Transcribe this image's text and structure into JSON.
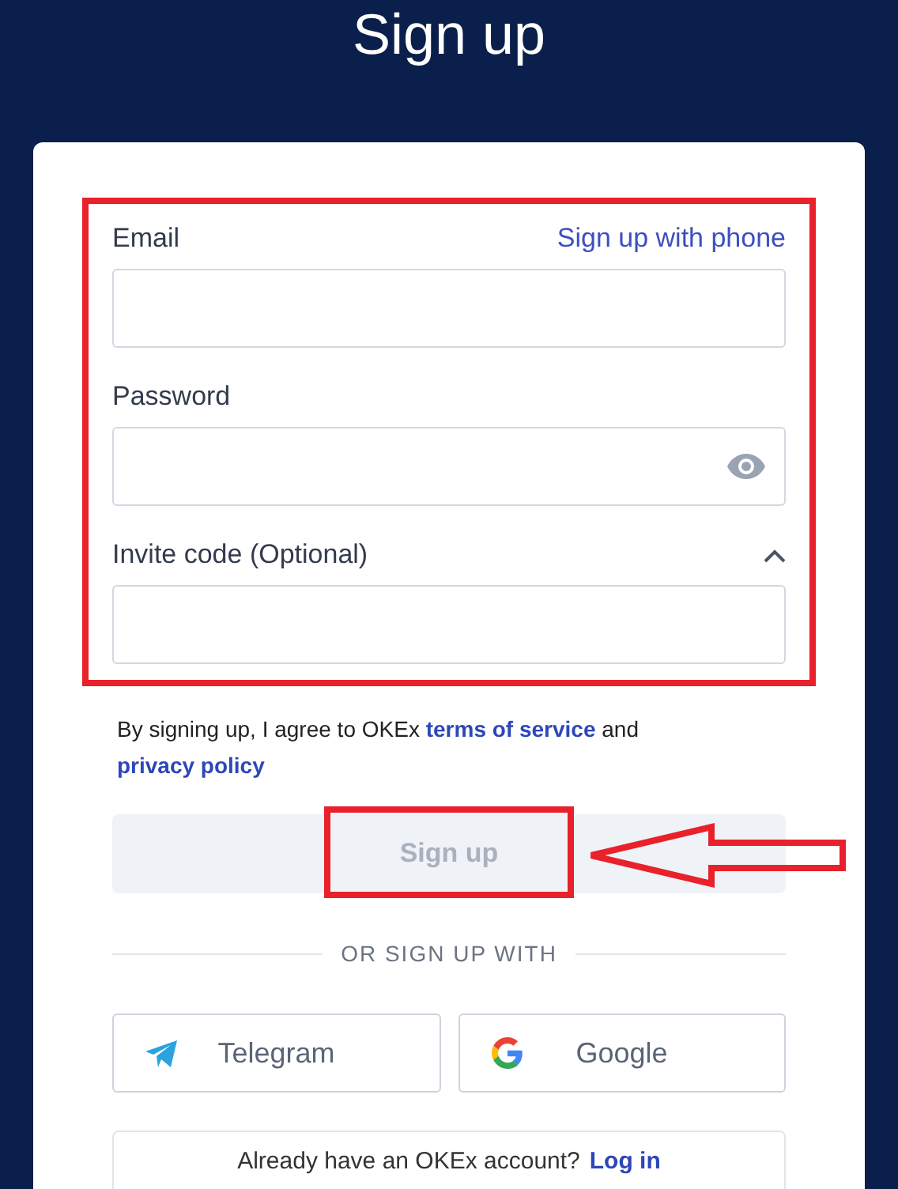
{
  "title": "Sign up",
  "form": {
    "phone_link": "Sign up with phone",
    "fields": [
      {
        "label": "Email",
        "kind": "text"
      },
      {
        "label": "Password",
        "kind": "password"
      },
      {
        "label": "Invite code (Optional)",
        "kind": "collapsible",
        "expanded": true
      }
    ]
  },
  "agreement": {
    "prefix": "By signing up, I agree to OKEx",
    "terms": "terms of service",
    "middle": "and",
    "privacy": "privacy policy"
  },
  "submit": {
    "label": "Sign up",
    "disabled": true
  },
  "divider": "OR SIGN UP WITH",
  "social": [
    {
      "label": "Telegram",
      "kind": "telegram"
    },
    {
      "label": "Google",
      "kind": "google"
    }
  ],
  "login": {
    "prompt": "Already have an OKEx account?",
    "link": "Log in"
  }
}
